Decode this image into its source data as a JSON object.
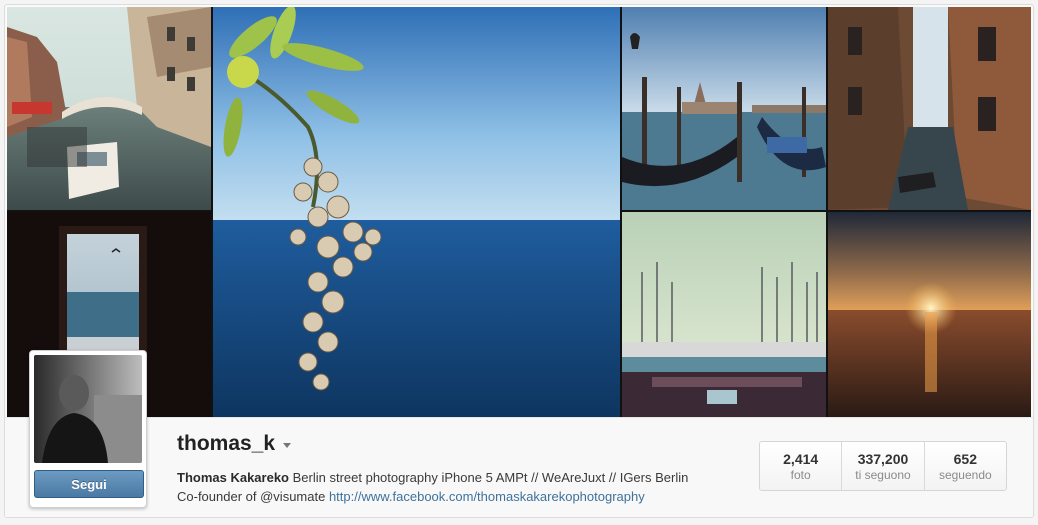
{
  "profile": {
    "username": "thomas_k",
    "full_name": "Thomas Kakareko",
    "bio_line1": " Berlin street photography iPhone 5 AMPt // WeAreJuxt // IGers Berlin",
    "bio_line2_prefix": "Co-founder of @visumate ",
    "website": "http://www.facebook.com/thomaskakarekophotography",
    "follow_label": "Segui"
  },
  "stats": [
    {
      "value": "2,414",
      "label": "foto"
    },
    {
      "value": "337,200",
      "label": "ti seguono"
    },
    {
      "value": "652",
      "label": "seguendo"
    }
  ],
  "photos": [
    {
      "name": "venice-canal-bridge"
    },
    {
      "name": "window-sea-view"
    },
    {
      "name": "blossom-branch-sea"
    },
    {
      "name": "gondolas-san-giorgio"
    },
    {
      "name": "venice-narrow-canal"
    },
    {
      "name": "marina-sailboats"
    },
    {
      "name": "sunset-over-sea"
    }
  ],
  "colors": {
    "accent_button": "#517fa4",
    "link": "#3f729b",
    "text": "#222222"
  }
}
